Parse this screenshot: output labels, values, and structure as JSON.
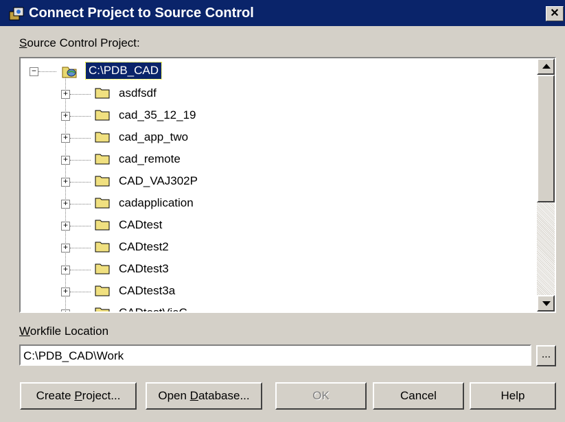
{
  "window": {
    "title": "Connect Project to Source Control",
    "close_label": "✕"
  },
  "source_label_prefix": "S",
  "source_label_rest": "ource Control Project:",
  "tree": {
    "root": {
      "label": "C:\\PDB_CAD",
      "expanded": true
    },
    "children": [
      "asdfsdf",
      "cad_35_12_19",
      "cad_app_two",
      "cad_remote",
      "CAD_VAJ302P",
      "cadapplication",
      "CADtest",
      "CADtest2",
      "CADtest3",
      "CADtest3a",
      "CADtestVieC"
    ]
  },
  "workfile_label_prefix": "W",
  "workfile_label_rest": "orkfile Location",
  "workfile_value": "C:\\PDB_CAD\\Work",
  "browse_label": "...",
  "buttons": {
    "create_pre": "Create ",
    "create_ul": "P",
    "create_post": "roject...",
    "open_pre": "Open ",
    "open_ul": "D",
    "open_post": "atabase...",
    "ok": "OK",
    "cancel": "Cancel",
    "help": "Help"
  },
  "colors": {
    "title_bar": "#0a246a",
    "dialog_face": "#d4d0c8",
    "selection": "#0a246a"
  }
}
